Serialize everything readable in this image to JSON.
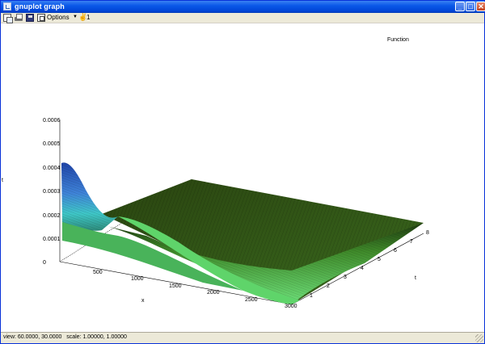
{
  "window": {
    "title": "gnuplot graph",
    "buttons": {
      "minimize": "_",
      "maximize": "□",
      "close": "✕"
    }
  },
  "toolbar": {
    "icons": [
      "copy-to-clipboard-icon",
      "print-icon",
      "save-icon",
      "options-icon",
      "mouse-icon"
    ],
    "options_label": "Options",
    "dropdown_glyph": "▼",
    "mouse_glyph": "✌",
    "mouse_number": "1"
  },
  "plot": {
    "key_title": "Function",
    "ylabel_fragment": "t",
    "x_axis_label": "x",
    "t_axis_label": "t",
    "z_ticks": [
      "0",
      "0.0001",
      "0.0002",
      "0.0003",
      "0.0004",
      "0.0005",
      "0.0006"
    ],
    "x_ticks": [
      "500",
      "1000",
      "1500",
      "2000",
      "2500",
      "3000"
    ],
    "t_ticks": [
      "1",
      "2",
      "3",
      "4",
      "5",
      "6",
      "7",
      "8"
    ],
    "colors": {
      "surface_top": "#2d4a10",
      "surface_front": "#62d56a",
      "peak_blue": "#2f63c8",
      "peak_cyan": "#3fc7c7"
    }
  },
  "status": {
    "text": "view: 60.0000, 30.0000   scale: 1.00000, 1.00000"
  }
}
